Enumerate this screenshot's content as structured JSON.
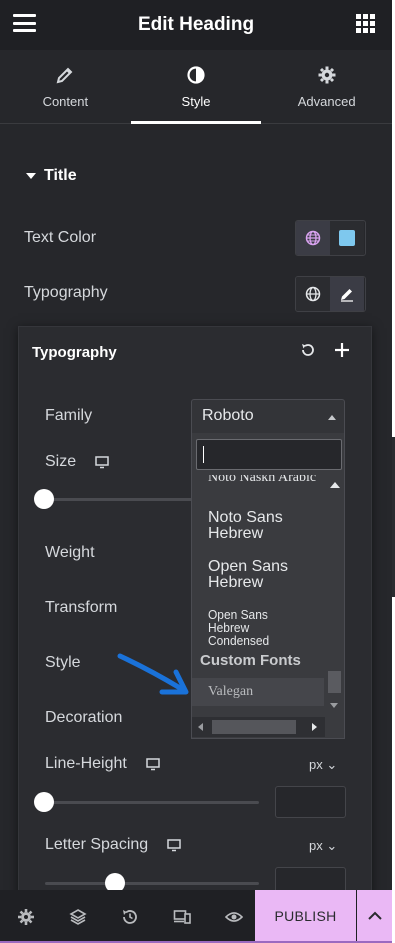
{
  "header": {
    "title": "Edit Heading"
  },
  "tabs": [
    {
      "label": "Content",
      "icon": "pencil-icon",
      "active": false
    },
    {
      "label": "Style",
      "icon": "contrast-icon",
      "active": true
    },
    {
      "label": "Advanced",
      "icon": "gear-icon",
      "active": false
    }
  ],
  "section": {
    "title": "Title"
  },
  "text_color": {
    "label": "Text Color",
    "swatch": "#7ec8ee"
  },
  "typography": {
    "label": "Typography"
  },
  "popover": {
    "title": "Typography",
    "family": {
      "label": "Family",
      "value": "Roboto",
      "search": ""
    },
    "size": {
      "label": "Size"
    },
    "weight": {
      "label": "Weight"
    },
    "transform": {
      "label": "Transform"
    },
    "style": {
      "label": "Style"
    },
    "decoration": {
      "label": "Decoration"
    },
    "line_height": {
      "label": "Line-Height",
      "unit": "px",
      "value": ""
    },
    "letter_spacing": {
      "label": "Letter Spacing",
      "unit": "px",
      "value": ""
    }
  },
  "dropdown": {
    "items": [
      "Noto Naskh Arabic",
      "Noto Sans Hebrew",
      "Open Sans Hebrew",
      "Open Sans Hebrew Condensed"
    ],
    "group": "Custom Fonts",
    "selected": "Valegan"
  },
  "footer": {
    "publish": "PUBLISH"
  },
  "colors": {
    "accent": "#eab8f5",
    "arrow": "#1a72d9"
  }
}
